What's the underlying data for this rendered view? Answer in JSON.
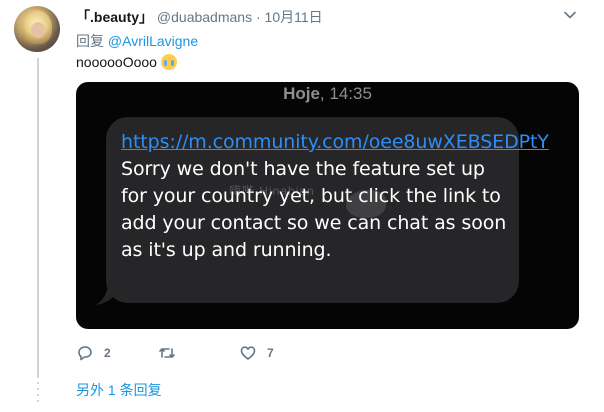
{
  "tweet": {
    "display_name": "「.beauty」",
    "handle": "@duabadmans",
    "separator": "·",
    "date": "10月11日",
    "reply_prefix": "回复",
    "reply_mention": "@AvrilLavigne",
    "text": "noooooOooo",
    "emoji_icon": "loudly-crying-face-icon"
  },
  "media": {
    "timestamp_day": "Hoje",
    "timestamp_time": "14:35",
    "message_link": "https://m.community.com/oee8uwXEBSEDPtY",
    "message_body": "Sorry we don't have the feature set up for your country yet, but click the link to add your contact so we can chat as soon as it's up and running.",
    "watermark_text": "嗨哔     Hinabian",
    "bubble_color": "#262628",
    "link_color": "#2e8ef3"
  },
  "actions": {
    "reply_count": "2",
    "retweet_count": "",
    "like_count": "7"
  },
  "footer": {
    "more_replies": "另外 1 条回复"
  },
  "colors": {
    "accent": "#1b95e0",
    "secondary_text": "#657786",
    "thread_line": "#ccd6dd"
  }
}
